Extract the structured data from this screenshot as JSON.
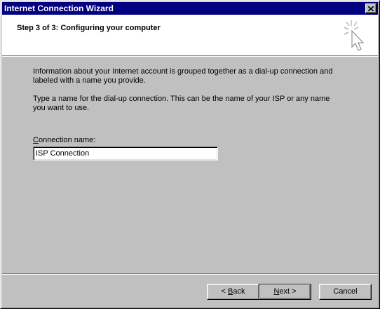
{
  "window": {
    "title": "Internet Connection Wizard"
  },
  "header": {
    "step_title": "Step 3 of 3: Configuring your computer"
  },
  "content": {
    "paragraph1": "Information about your Internet account is grouped together as a dial-up connection and labeled with a name you provide.",
    "paragraph2": "Type a name for the dial-up connection. This can be the name of your ISP or any name you want to use.",
    "connection_label_accel": "C",
    "connection_label_rest": "onnection name:",
    "connection_value": "ISP Connection"
  },
  "buttons": {
    "back_prefix": "< ",
    "back_accel": "B",
    "back_rest": "ack",
    "next_accel": "N",
    "next_rest": "ext >",
    "cancel": "Cancel"
  },
  "icons": {
    "close": "close-icon",
    "wizard": "wizard-cursor-icon"
  },
  "colors": {
    "titlebar": "#000080",
    "face": "#c0c0c0",
    "header_bg": "#ffffff"
  }
}
